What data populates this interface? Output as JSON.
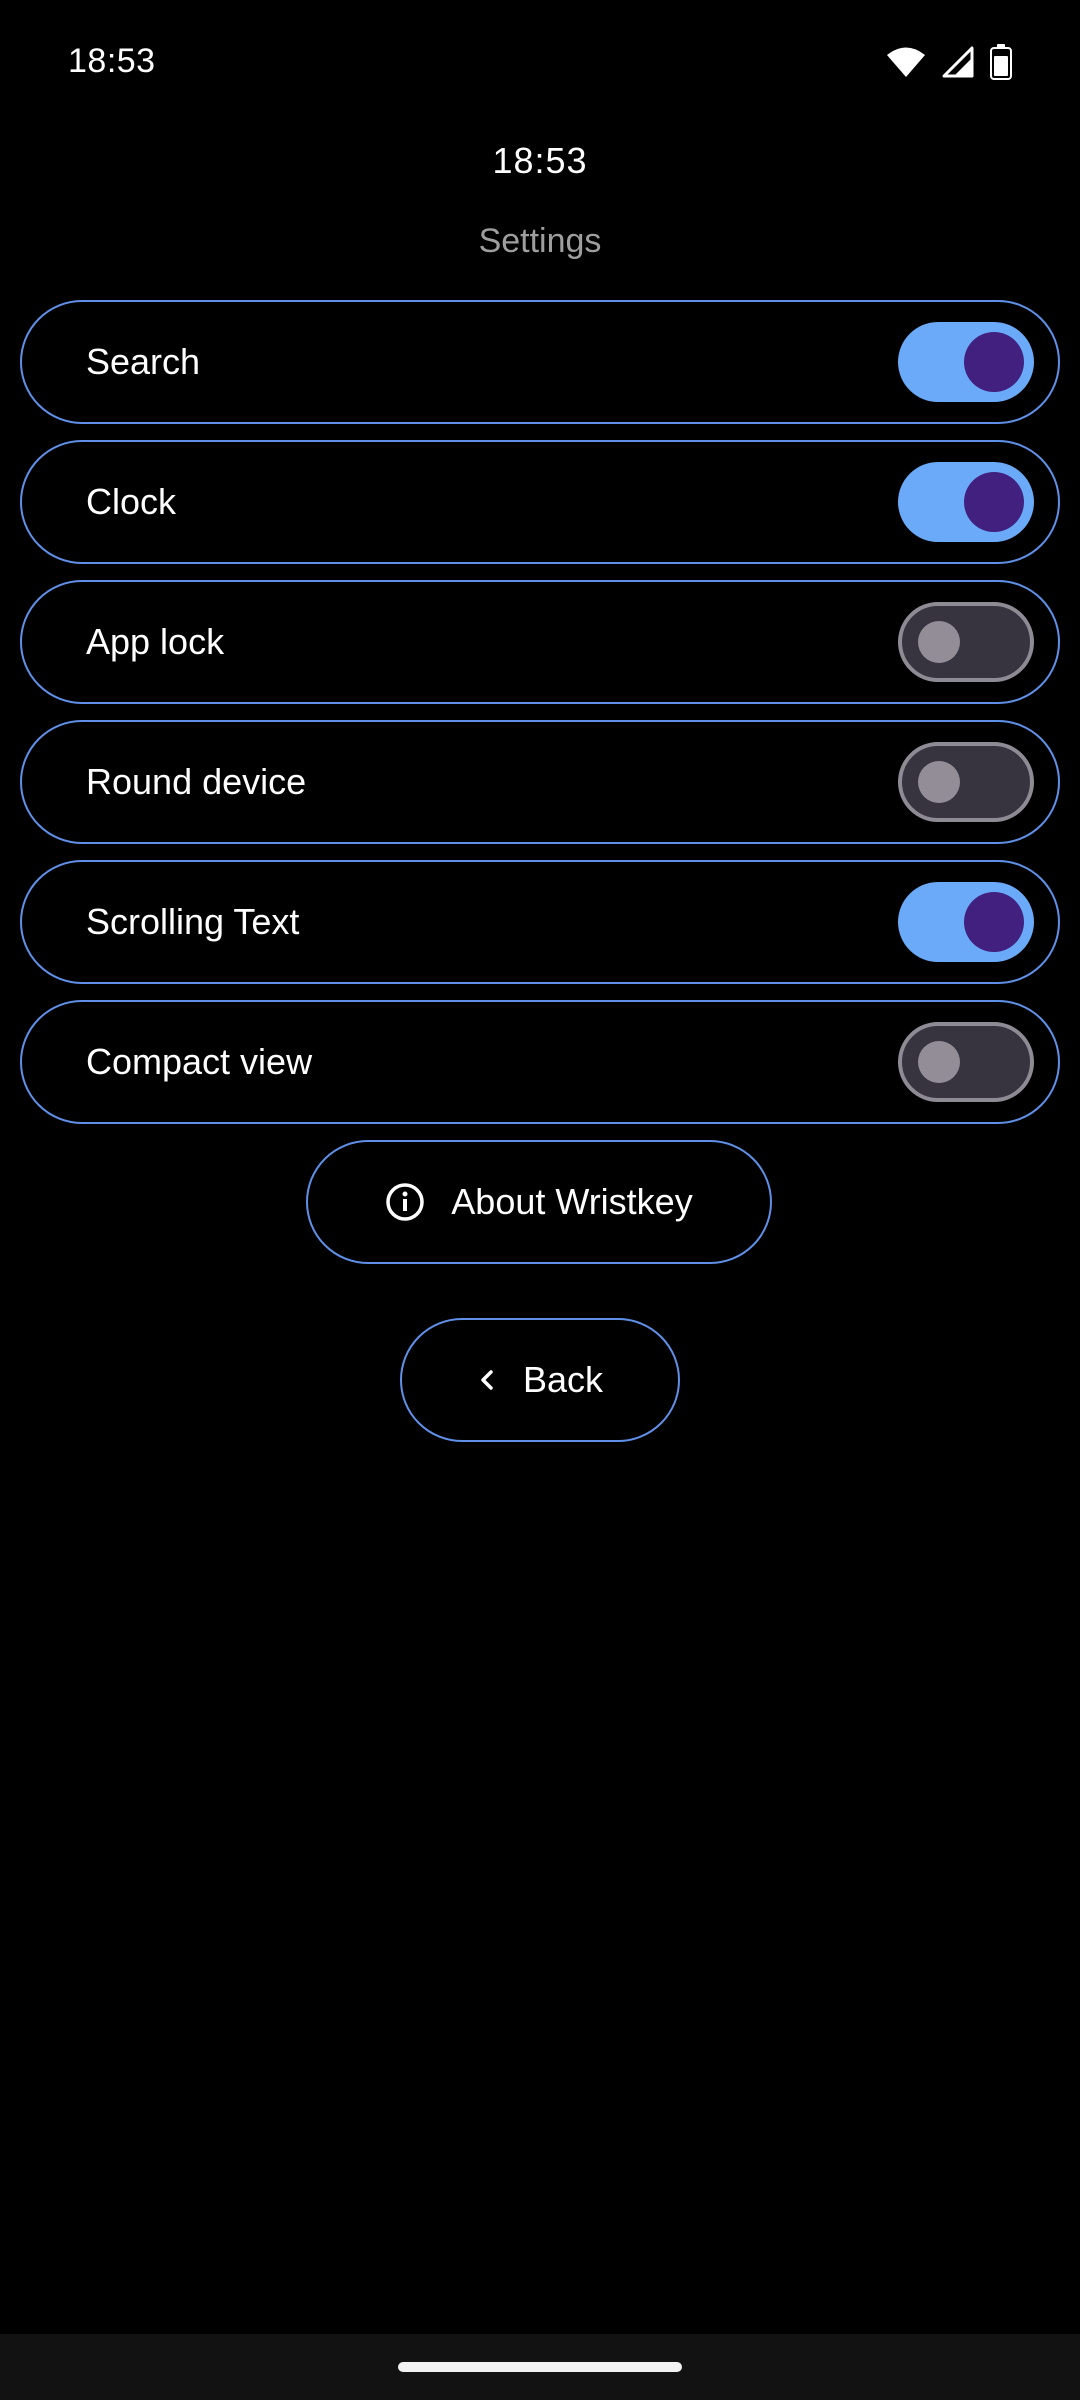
{
  "status_bar": {
    "time": "18:53",
    "icons": [
      "wifi-icon",
      "cell-signal-icon",
      "battery-icon"
    ]
  },
  "app": {
    "clock": "18:53",
    "title": "Settings"
  },
  "settings": [
    {
      "label": "Search",
      "enabled": true
    },
    {
      "label": "Clock",
      "enabled": true
    },
    {
      "label": "App lock",
      "enabled": false
    },
    {
      "label": "Round device",
      "enabled": false
    },
    {
      "label": "Scrolling Text",
      "enabled": true
    },
    {
      "label": "Compact view",
      "enabled": false
    }
  ],
  "buttons": {
    "about": {
      "label": "About Wristkey",
      "icon": "info-icon"
    },
    "back": {
      "label": "Back",
      "icon": "chevron-left-icon"
    }
  },
  "colors": {
    "accent_outline": "#5f8fe6",
    "toggle_on_track": "#6aaaf8",
    "toggle_on_knob": "#42207f",
    "toggle_off_track": "#37343f",
    "toggle_off_knob": "#938d98",
    "background": "#000000"
  }
}
